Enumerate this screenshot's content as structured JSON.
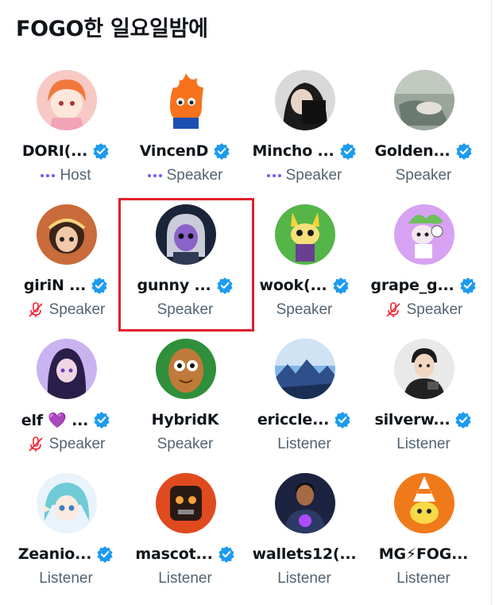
{
  "space": {
    "title": "FOGO한 일요일밤에"
  },
  "colors": {
    "verified": "#1d9bf0",
    "host_dots": "#7856ff",
    "muted_mic": "#f4212e",
    "highlight": "#e0202b"
  },
  "participants": [
    {
      "name": "DORI(...",
      "role": "Host",
      "role_icon": "host-dots",
      "verified": true
    },
    {
      "name": "VincenD",
      "role": "Speaker",
      "role_icon": "host-dots",
      "verified": true
    },
    {
      "name": "Mincho ...",
      "role": "Speaker",
      "role_icon": "host-dots",
      "verified": true
    },
    {
      "name": "Golden...",
      "role": "Speaker",
      "role_icon": "none",
      "verified": true
    },
    {
      "name": "giriN ...",
      "role": "Speaker",
      "role_icon": "muted-mic",
      "verified": true
    },
    {
      "name": "gunny ...",
      "role": "Speaker",
      "role_icon": "none",
      "verified": true
    },
    {
      "name": "wook(...",
      "role": "Speaker",
      "role_icon": "none",
      "verified": true
    },
    {
      "name": "grape_g...",
      "role": "Speaker",
      "role_icon": "muted-mic",
      "verified": true
    },
    {
      "name": "elf 💜 ...",
      "role": "Speaker",
      "role_icon": "muted-mic",
      "verified": true
    },
    {
      "name": "HybridK",
      "role": "Speaker",
      "role_icon": "none",
      "verified": false
    },
    {
      "name": "ericcle...",
      "role": "Listener",
      "role_icon": "none",
      "verified": true
    },
    {
      "name": "silverw...",
      "role": "Listener",
      "role_icon": "none",
      "verified": true
    },
    {
      "name": "Zeanio...",
      "role": "Listener",
      "role_icon": "none",
      "verified": true
    },
    {
      "name": "mascot...",
      "role": "Listener",
      "role_icon": "none",
      "verified": true
    },
    {
      "name": "wallets12(...",
      "role": "Listener",
      "role_icon": "none",
      "verified": false
    },
    {
      "name": "MG⚡FOG...",
      "role": "Listener",
      "role_icon": "none",
      "verified": false
    }
  ]
}
